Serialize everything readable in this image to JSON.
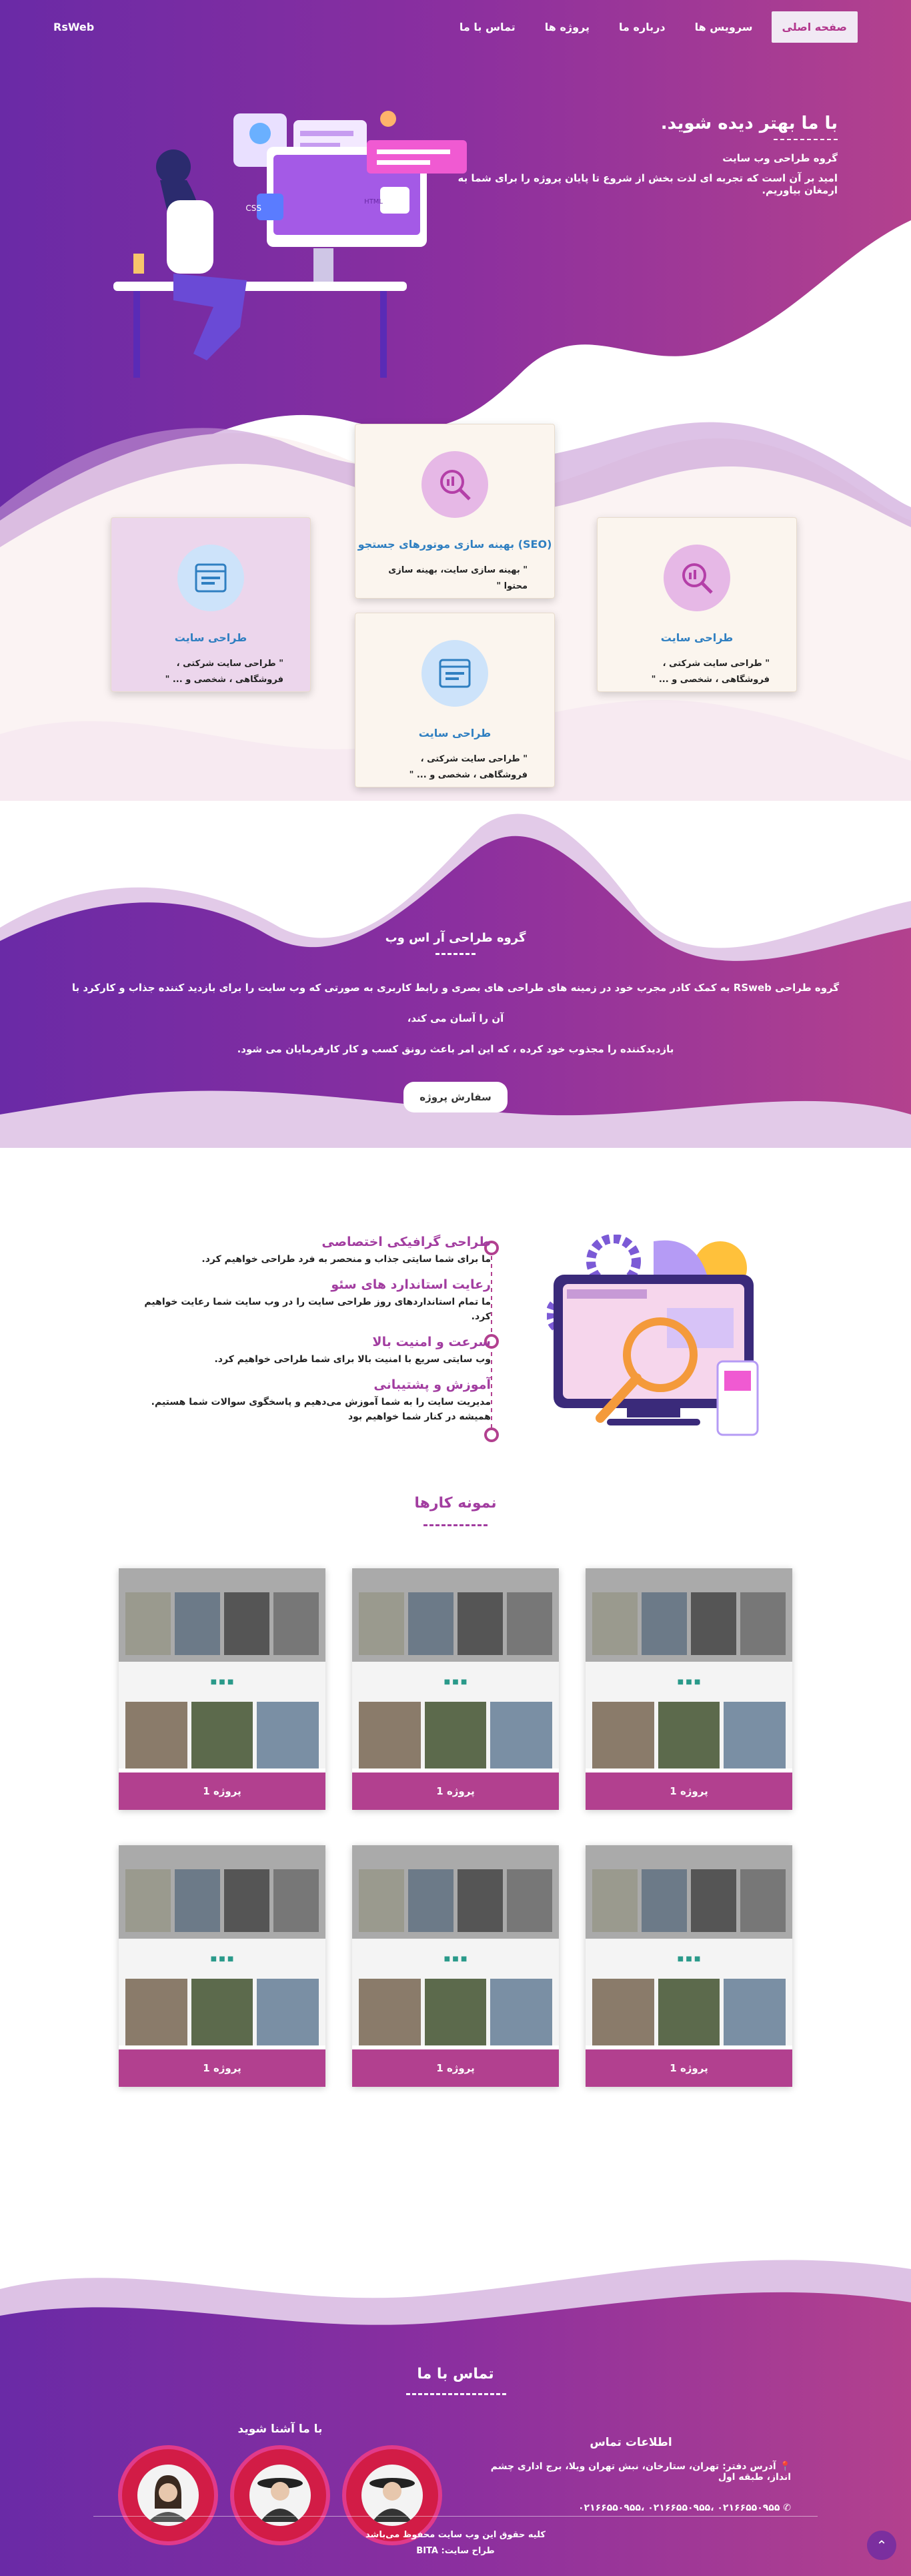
{
  "nav": {
    "logo": "RsWeb",
    "items": [
      "صفحه اصلی",
      "سرویس ها",
      "درباره ما",
      "پروژه ها",
      "تماس با ما"
    ]
  },
  "hero": {
    "title": "با ما بهتر دیده شوید.",
    "subtitle": "گروه طراحی وب سایت",
    "text": "امید بر آن است که تجربه ای لذت بخش از شروع تا پایان پروژه را برای شما به ارمغان بیاوریم."
  },
  "services": [
    {
      "title": "(SEO) بهینه سازی موتورهای جستجو",
      "text": "\" بهینه سازی سایت، بهینه سازی محتوا \""
    },
    {
      "title": "طراحی سایت",
      "text": "\" طراحی سایت شرکتی ، فروشگاهی ، شخصی و ... \""
    },
    {
      "title": "طراحی سایت",
      "text": "\" طراحی سایت شرکتی ، فروشگاهی ، شخصی و ... \""
    },
    {
      "title": "طراحی سایت",
      "text": "\" طراحی سایت شرکتی ، فروشگاهی ، شخصی و ... \""
    }
  ],
  "about": {
    "title": "گروه طراحی آر اس وب",
    "line1": "گروه طراحی RSweb به کمک کادر مجرب خود در زمینه های طراحی های بصری و رابط کاربری به صورتی که وب سایت را برای بازدید کننده جذاب و کارکرد با آن را آسان می کند،",
    "line2": "بازدیدکننده را مجذوب خود کرده ، که این امر باعث رونق کسب و کار کارفرمایان می شود.",
    "button": "سفارش پروژه"
  },
  "features": [
    {
      "title": "طراحی گرافیکی اختصاصی",
      "text": "ما برای شما سایتی جذاب و منحصر به فرد طراحی خواهیم کرد."
    },
    {
      "title": "رعایت استاندارد های سئو",
      "text": "ما تمام استانداردهای روز طراحی سایت را در وب سایت شما رعایت خواهیم کرد."
    },
    {
      "title": "سرعت و امنیت بالا",
      "text": "وب سایتی سریع با امنیت بالا برای شما طراحی خواهیم کرد."
    },
    {
      "title": "آموزش و پشتیبانی",
      "text": "مدیریت سایت را به شما آموزش می‌دهیم و پاسخگوی سوالات شما هستیم. همیشه در کنار شما خواهیم بود"
    }
  ],
  "portfolio": {
    "title": "نمونه کارها",
    "projects": [
      "پروژه 1",
      "پروژه 1",
      "پروژه 1",
      "پروژه 1",
      "پروژه 1",
      "پروژه 1"
    ]
  },
  "contact": {
    "title": "تماس با ما",
    "info_title": "اطلاعات تماس",
    "address": "آدرس دفتر: تهران، ستارخان، نبش تهران ویلا، برج اداری چشم انداز، طبقه اول",
    "phones": "۰۲۱۶۶۵۵۰۹۵۵ ،۰۲۱۶۶۵۵۰۹۵۵ ،۰۲۱۶۶۵۵۰۹۵۵",
    "team_title": "با ما آشنا شوید"
  },
  "footer": {
    "copyright": "کلیه حقوق این وب سایت محفوظ می‌باشد",
    "designer": "طراح سایت: BITA"
  },
  "colors": {
    "accent": "#a23da0",
    "purple": "#6a2aa6",
    "magenta": "#b3418e",
    "card": "#fbf5ee",
    "link": "#2f7fc1"
  }
}
